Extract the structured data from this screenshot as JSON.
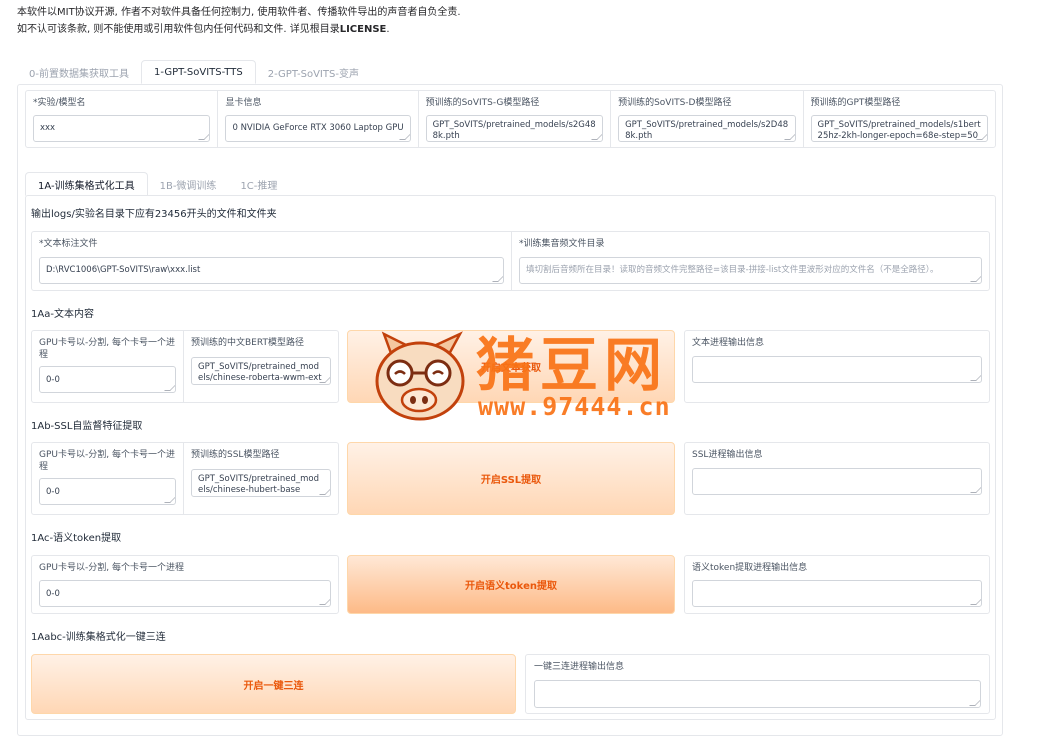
{
  "notice": {
    "line1": "本软件以MIT协议开源, 作者不对软件具备任何控制力, 使用软件者、传播软件导出的声音者自负全责.",
    "line2_prefix": "如不认可该条款, 则不能使用或引用软件包内任何代码和文件. 详见根目录",
    "line2_bold": "LICENSE",
    "line2_suffix": "."
  },
  "main_tabs": [
    {
      "label": "0-前置数据集获取工具"
    },
    {
      "label": "1-GPT-SoVITS-TTS"
    },
    {
      "label": "2-GPT-SoVITS-变声"
    }
  ],
  "top_fields": {
    "exp_name": {
      "label": "*实验/模型名",
      "value": "xxx"
    },
    "gpu_info": {
      "label": "显卡信息",
      "value": "0 NVIDIA GeForce RTX 3060 Laptop GPU"
    },
    "sovits_g": {
      "label": "预训练的SoVITS-G模型路径",
      "value": "GPT_SoVITS/pretrained_models/s2G488k.pth"
    },
    "sovits_d": {
      "label": "预训练的SoVITS-D模型路径",
      "value": "GPT_SoVITS/pretrained_models/s2D488k.pth"
    },
    "gpt": {
      "label": "预训练的GPT模型路径",
      "value": "GPT_SoVITS/pretrained_models/s1bert25hz-2kh-longer-epoch=68e-step=50232.ckpt"
    }
  },
  "sub_tabs": [
    {
      "label": "1A-训练集格式化工具"
    },
    {
      "label": "1B-微调训练"
    },
    {
      "label": "1C-推理"
    }
  ],
  "header_note": "输出logs/实验名目录下应有23456开头的文件和文件夹",
  "files": {
    "text_label": {
      "label": "*文本标注文件",
      "value": "D:\\RVC1006\\GPT-SoVITS\\raw\\xxx.list"
    },
    "audio_dir": {
      "label": "*训练集音频文件目录",
      "placeholder": "填切割后音频所在目录！读取的音频文件完整路径=该目录-拼接-list文件里波形对应的文件名（不是全路径）。"
    }
  },
  "s1a": {
    "title": "1Aa-文本内容",
    "gpu_label": "GPU卡号以-分割, 每个卡号一个进程",
    "gpu_value": "0-0",
    "model_label": "预训练的中文BERT模型路径",
    "model_value": "GPT_SoVITS/pretrained_models/chinese-roberta-wwm-ext-large",
    "button": "开启文本获取",
    "out_label": "文本进程输出信息"
  },
  "s1b": {
    "title": "1Ab-SSL自监督特征提取",
    "gpu_label": "GPU卡号以-分割, 每个卡号一个进程",
    "gpu_value": "0-0",
    "model_label": "预训练的SSL模型路径",
    "model_value": "GPT_SoVITS/pretrained_models/chinese-hubert-base",
    "button": "开启SSL提取",
    "out_label": "SSL进程输出信息"
  },
  "s1c": {
    "title": "1Ac-语义token提取",
    "gpu_label": "GPU卡号以-分割, 每个卡号一个进程",
    "gpu_value": "0-0",
    "button": "开启语义token提取",
    "out_label": "语义token提取进程输出信息"
  },
  "s1abc": {
    "title": "1Aabc-训练集格式化一键三连",
    "button": "开启一键三连",
    "out_label": "一键三连进程输出信息"
  },
  "watermark": {
    "brand": "猪豆网",
    "url": "www.97444.cn"
  },
  "colors": {
    "accent": "#f97316",
    "button_text": "#ea580c",
    "border": "#e5e7eb"
  }
}
